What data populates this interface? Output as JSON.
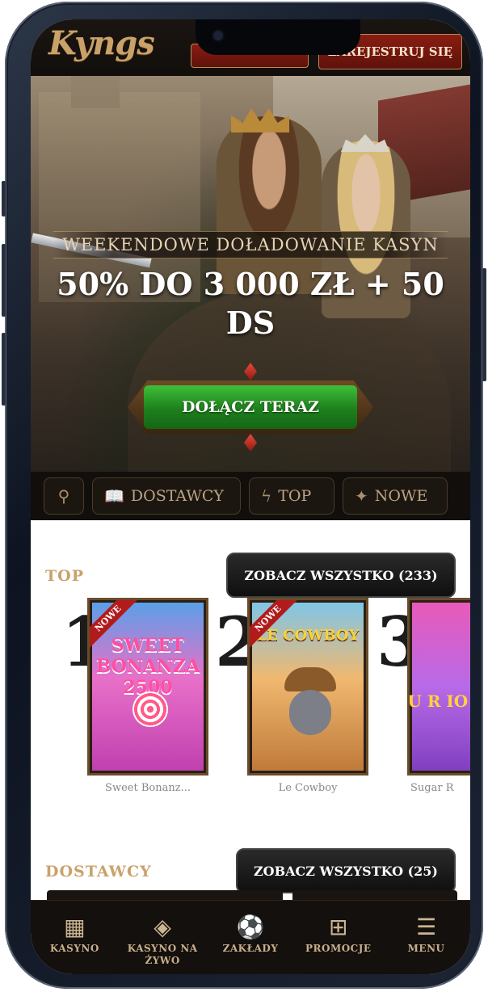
{
  "header": {
    "logo": "Kyngs",
    "login_label": "",
    "register_label": "ZAREJESTRUJ SIĘ"
  },
  "hero": {
    "promo_subtitle": "WEEKENDOWE DOŁADOWANIE KASYN",
    "promo_title": "50% DO 3 000 ZŁ + 50 DS",
    "cta_label": "DOŁĄCZ TERAZ",
    "slides_total": 7,
    "slide_active": 3
  },
  "tabs": [
    {
      "icon": "search-icon",
      "label": ""
    },
    {
      "icon": "book-icon",
      "label": "DOSTAWCY"
    },
    {
      "icon": "lightning-icon",
      "label": "TOP"
    },
    {
      "icon": "gift-box-icon",
      "label": "NOWE"
    }
  ],
  "top_section": {
    "title": "TOP",
    "view_all_label": "ZOBACZ WSZYSTKO (233)",
    "games": [
      {
        "rank": "1",
        "badge": "NOWE",
        "title": "Sweet Bonanz...",
        "art": "SWEET BONANZA 2500"
      },
      {
        "rank": "2",
        "badge": "NOWE",
        "title": "Le Cowboy",
        "art": "LE COWBOY"
      },
      {
        "rank": "3",
        "badge": "",
        "title": "Sugar R",
        "art": "SU R IO"
      }
    ]
  },
  "providers_section": {
    "title": "DOSTAWCY",
    "view_all_label": "ZOBACZ WSZYSTKO (25)"
  },
  "bottom_nav": [
    {
      "icon": "slot-machine-icon",
      "label": "KASYNO"
    },
    {
      "icon": "cards-icon",
      "label": "KASYNO NA ŻYWO"
    },
    {
      "icon": "football-icon",
      "label": "ZAKŁADY"
    },
    {
      "icon": "gift-icon",
      "label": "PROMOCJE"
    },
    {
      "icon": "menu-search-icon",
      "label": "MENU"
    }
  ],
  "colors": {
    "accent_gold": "#c9a26a",
    "register_red": "#8a1d12",
    "cta_green": "#1d7f1c",
    "dark_bg": "#120e0b"
  }
}
